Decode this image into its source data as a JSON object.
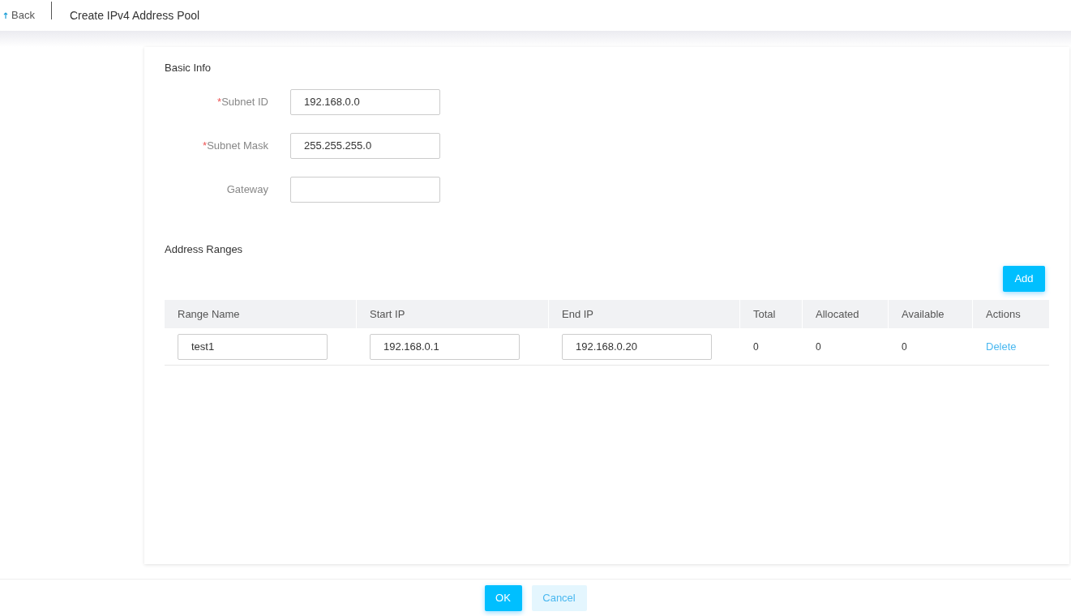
{
  "header": {
    "back": "Back",
    "title": "Create IPv4 Address Pool"
  },
  "basic_info": {
    "title": "Basic Info",
    "fields": [
      {
        "required_mark": "*",
        "label": "Subnet ID",
        "value": "192.168.0.0"
      },
      {
        "required_mark": "*",
        "label": "Subnet Mask",
        "value": "255.255.255.0"
      },
      {
        "label": "Gateway"
      }
    ]
  },
  "address_ranges": {
    "title": "Address Ranges",
    "add_button": "Add",
    "columns": [
      "Range Name",
      "Start IP",
      "End IP",
      "Total",
      "Allocated",
      "Available",
      "Actions"
    ],
    "rows": [
      {
        "range_name": "test1",
        "start_ip": "192.168.0.1",
        "end_ip": "192.168.0.20",
        "total": "0",
        "allocated": "0",
        "available": "0",
        "action": "Delete"
      }
    ]
  },
  "footer": {
    "ok": "OK",
    "cancel": "Cancel"
  }
}
